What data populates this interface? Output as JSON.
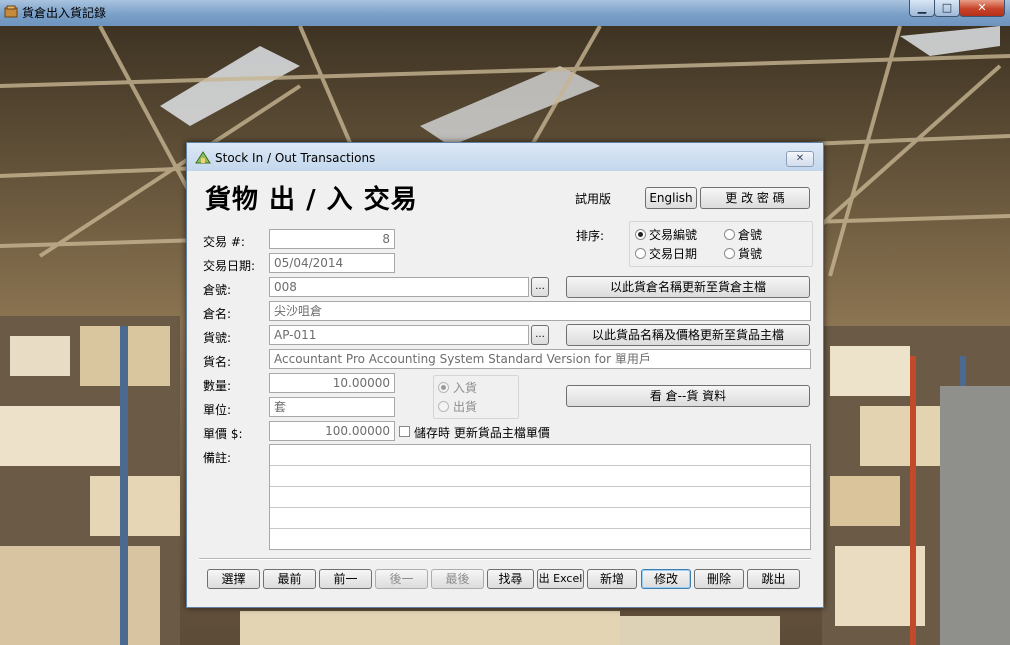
{
  "window": {
    "title": "貨倉出入貨記錄"
  },
  "dialog": {
    "title": "Stock In / Out Transactions",
    "heading": "貨物 出 / 入 交易",
    "trial_label": "試用版",
    "english_button": "English",
    "change_password_button": "更 改 密 碼",
    "sort": {
      "label": "排序:",
      "options": [
        {
          "label": "交易編號",
          "selected": true
        },
        {
          "label": "倉號",
          "selected": false
        },
        {
          "label": "交易日期",
          "selected": false
        },
        {
          "label": "貨號",
          "selected": false
        }
      ]
    },
    "fields": {
      "txn_no": {
        "label": "交易 #:",
        "value": "8"
      },
      "txn_date": {
        "label": "交易日期:",
        "value": "05/04/2014"
      },
      "warehouse_no": {
        "label": "倉號:",
        "value": "008"
      },
      "warehouse_name": {
        "label": "倉名:",
        "value": "尖沙咀倉"
      },
      "item_no": {
        "label": "貨號:",
        "value": "AP-011"
      },
      "item_name": {
        "label": "貨名:",
        "value": "Accountant Pro Accounting System Standard Version for 單用戶"
      },
      "quantity": {
        "label": "數量:",
        "value": "10.00000"
      },
      "unit": {
        "label": "單位:",
        "value": "套"
      },
      "unit_price": {
        "label": "單價 $:",
        "value": "100.00000"
      },
      "notes": {
        "label": "備註:",
        "value": ""
      }
    },
    "lookup_button": "...",
    "update_warehouse_button": "以此貨倉名稱更新至貨倉主檔",
    "update_item_button": "以此貨品名稱及價格更新至貨品主檔",
    "view_stock_button": "看 倉--貨 資料",
    "direction": {
      "options": [
        {
          "label": "入貨",
          "selected": true
        },
        {
          "label": "出貨",
          "selected": false
        }
      ]
    },
    "update_price_checkbox": {
      "label": "儲存時 更新貨品主檔單價",
      "checked": false
    },
    "toolbar": {
      "select": "選擇",
      "first": "最前",
      "prev": "前一",
      "next": "後一",
      "last": "最後",
      "find": "找尋",
      "excel": "出 Excel",
      "add": "新增",
      "edit": "修改",
      "delete": "刪除",
      "exit": "跳出"
    }
  }
}
